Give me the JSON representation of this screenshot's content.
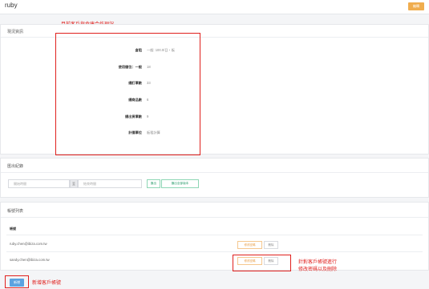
{
  "header": {
    "title": "ruby",
    "edit_label": "編輯"
  },
  "annotations": {
    "info_note": "目前客戶與倉庫合作現況",
    "account_note_1": "針對客戶帳號進行",
    "account_note_2": "修改密碼以及刪除",
    "add_note": "新增客戶帳號"
  },
  "status_panel": {
    "title": "現況資訊",
    "rows": [
      {
        "label": "倉租",
        "value": "一般: 100.0/日・板"
      },
      {
        "label": "使用儲位：一般",
        "value": "18"
      },
      {
        "label": "總訂單數",
        "value": "33"
      },
      {
        "label": "總商品數",
        "value": "6"
      },
      {
        "label": "總出貨單數",
        "value": "9"
      },
      {
        "label": "計價單位",
        "value": "板租計算"
      }
    ]
  },
  "export_panel": {
    "title": "匯出紀錄",
    "start_placeholder": "開始時間",
    "separator": "至",
    "end_placeholder": "結束時間",
    "export_label": "匯出",
    "export_all_label": "匯出全部版本"
  },
  "accounts_panel": {
    "title": "帳號列表",
    "column_header": "帳號",
    "rows": [
      {
        "email": "ruby.chen@ibiza.com.tw",
        "change_pw": "修改密碼",
        "delete": "刪除"
      },
      {
        "email": "sandy.chen@ibiza.com.tw",
        "change_pw": "修改密碼",
        "delete": "刪除"
      }
    ],
    "add_label": "新增"
  }
}
